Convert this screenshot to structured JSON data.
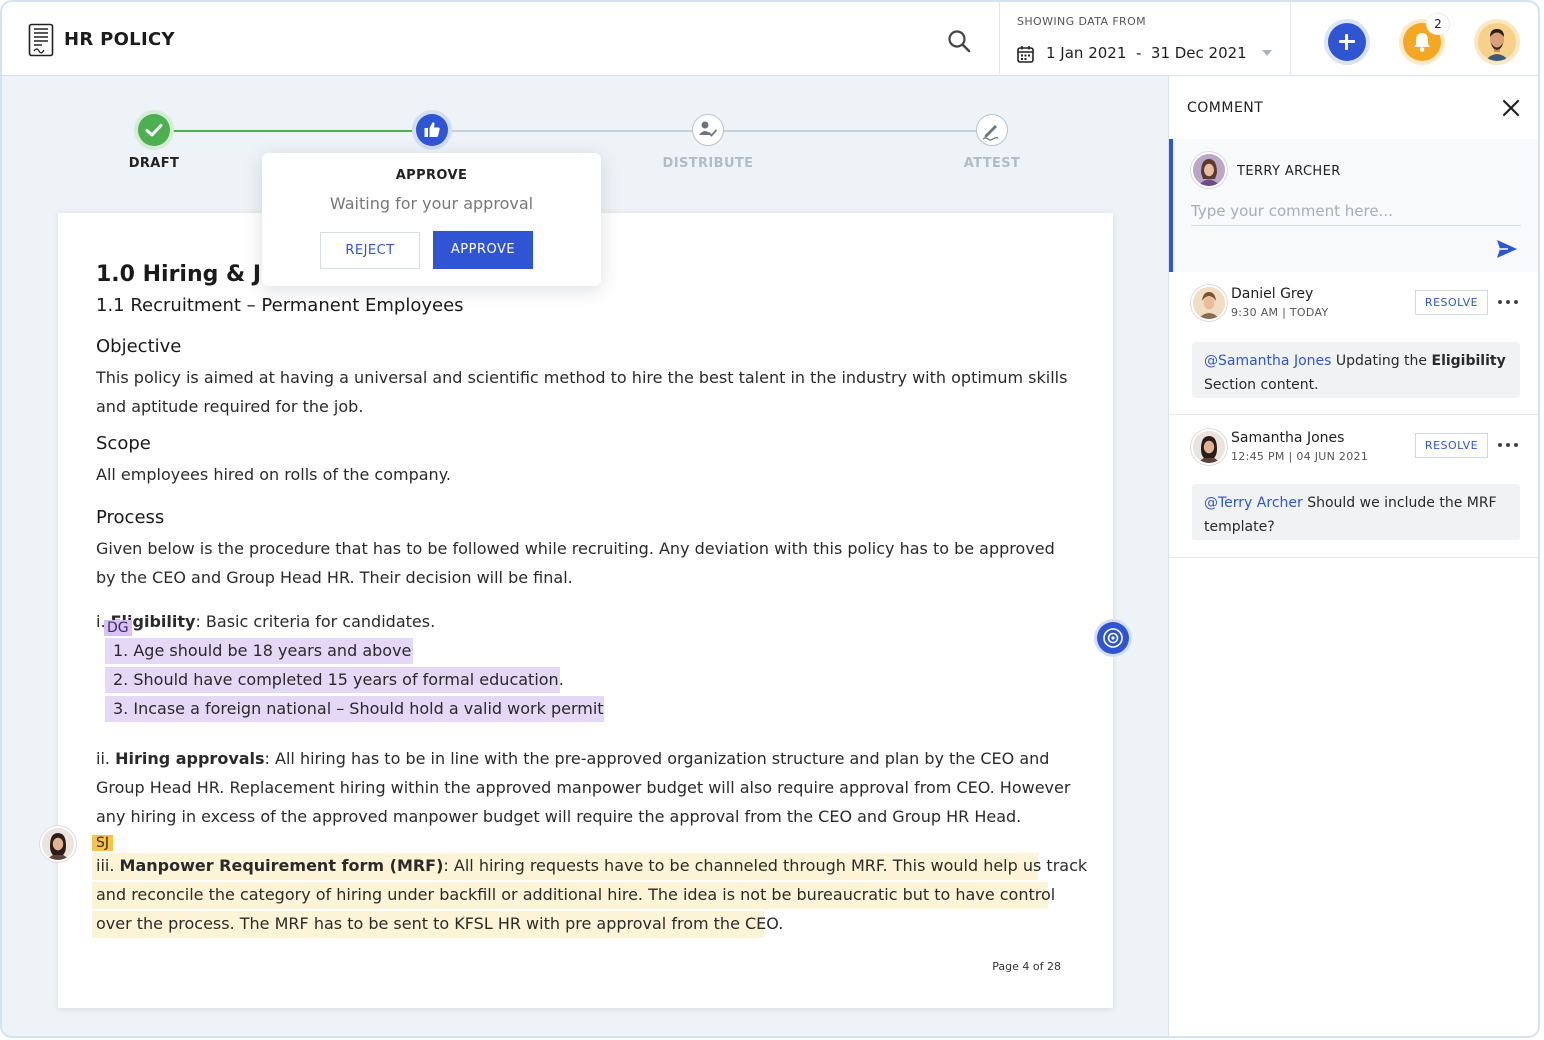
{
  "app": {
    "title": "HR POLICY"
  },
  "header": {
    "date_caption": "SHOWING DATA FROM",
    "date_start": "1 Jan 2021",
    "date_sep": "-",
    "date_end": "31 Dec 2021",
    "notification_count": "2"
  },
  "stepper": {
    "steps": [
      {
        "label": "DRAFT",
        "state": "done",
        "icon": "check-icon"
      },
      {
        "label": "APPROVE",
        "state": "current",
        "icon": "thumbs-up-icon"
      },
      {
        "label": "DISTRIBUTE",
        "state": "pending",
        "icon": "user-check-icon"
      },
      {
        "label": "ATTEST",
        "state": "pending",
        "icon": "signature-icon"
      }
    ]
  },
  "popup": {
    "title": "APPROVE",
    "subtitle": "Waiting for your approval",
    "reject_label": "REJECT",
    "approve_label": "APPROVE"
  },
  "document": {
    "h1_visible": "1.0 Hiring & Jo",
    "h2": "1.1 Recruitment – Permanent Employees",
    "objective_heading": "Objective",
    "objective_line1": "This policy is aimed at having a universal and scientific method to hire the best talent in the industry with optimum skills",
    "objective_line2": "and aptitude required for the job.",
    "scope_heading": "Scope",
    "scope_text": "All employees hired on rolls of the company.",
    "process_heading": "Process",
    "process_line1": "Given below is the procedure that has to be followed while recruiting. Any deviation with this policy has to be approved",
    "process_line2": "by the CEO and Group Head HR. Their decision will be final.",
    "eligibility_prefix": "i. ",
    "eligibility_term": "Eligibility",
    "eligibility_rest": ": Basic criteria for candidates.",
    "dg_tag": "DG",
    "criteria": [
      "1.  Age should be 18 years and above",
      "2. Should have completed 15 years of formal education.",
      "3. Incase a foreign national – Should hold a valid work permit"
    ],
    "approvals_prefix": "ii. ",
    "approvals_term": "Hiring approvals",
    "approvals_line1_rest": ": All hiring has to be in line with the pre-approved organization structure and plan by the CEO and",
    "approvals_line2": "Group Head HR. Replacement hiring within the approved manpower budget will also require approval from CEO. However",
    "approvals_line3": "any hiring in excess of the approved manpower budget will require the approval from the CEO and Group HR Head.",
    "sj_tag": "SJ",
    "mrf_prefix": "iii. ",
    "mrf_term": "Manpower Requirement form (MRF)",
    "mrf_line1_rest": ": All hiring requests have to be channeled through MRF. This would help us track",
    "mrf_line2": "and reconcile the category of hiring under backfill or additional hire. The idea is not be bureaucratic but to have control",
    "mrf_line3": "over the process. The MRF has to be sent to KFSL HR with pre approval from the CEO.",
    "page_indicator": "Page 4 of 28"
  },
  "comments": {
    "title": "COMMENT",
    "composer": {
      "name": "TERRY ARCHER",
      "placeholder": "Type your comment here..."
    },
    "threads": [
      {
        "author": "Daniel Grey",
        "time": "9:30 AM  |  TODAY",
        "resolve_label": "RESOLVE",
        "mention": "@Samantha Jones",
        "text_a": " Updating the ",
        "text_bold": "Eligibility",
        "text_b": " Section content."
      },
      {
        "author": "Samantha Jones",
        "time": "12:45 PM  |  04 JUN 2021",
        "resolve_label": "RESOLVE",
        "mention": "@Terry Archer",
        "text_a": " Should we include the MRF template?"
      }
    ]
  },
  "colors": {
    "accent": "#2f55d4",
    "success": "#4caf50",
    "warning": "#f5a623",
    "highlight_purple": "#e5d7f6",
    "highlight_yellow": "#fdf3d6"
  }
}
